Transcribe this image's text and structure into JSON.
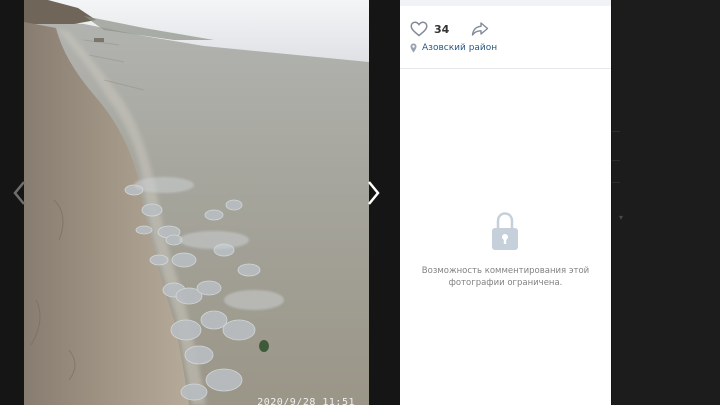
{
  "photo": {
    "date_stamp": "2020/9/28  11:51",
    "icons": {
      "prev": "chevron-left-icon",
      "next": "chevron-right-icon"
    }
  },
  "side_panel": {
    "likes_count": "34",
    "location": "Азовский район",
    "comments_restricted": "Возможность комментирования этой фотографии ограничена.",
    "icons": {
      "like": "heart-icon",
      "share": "share-icon",
      "location": "pin-icon",
      "lock": "lock-icon"
    },
    "colors": {
      "link": "#2a5885",
      "muted": "#828282",
      "icon": "#99a2ad"
    }
  }
}
